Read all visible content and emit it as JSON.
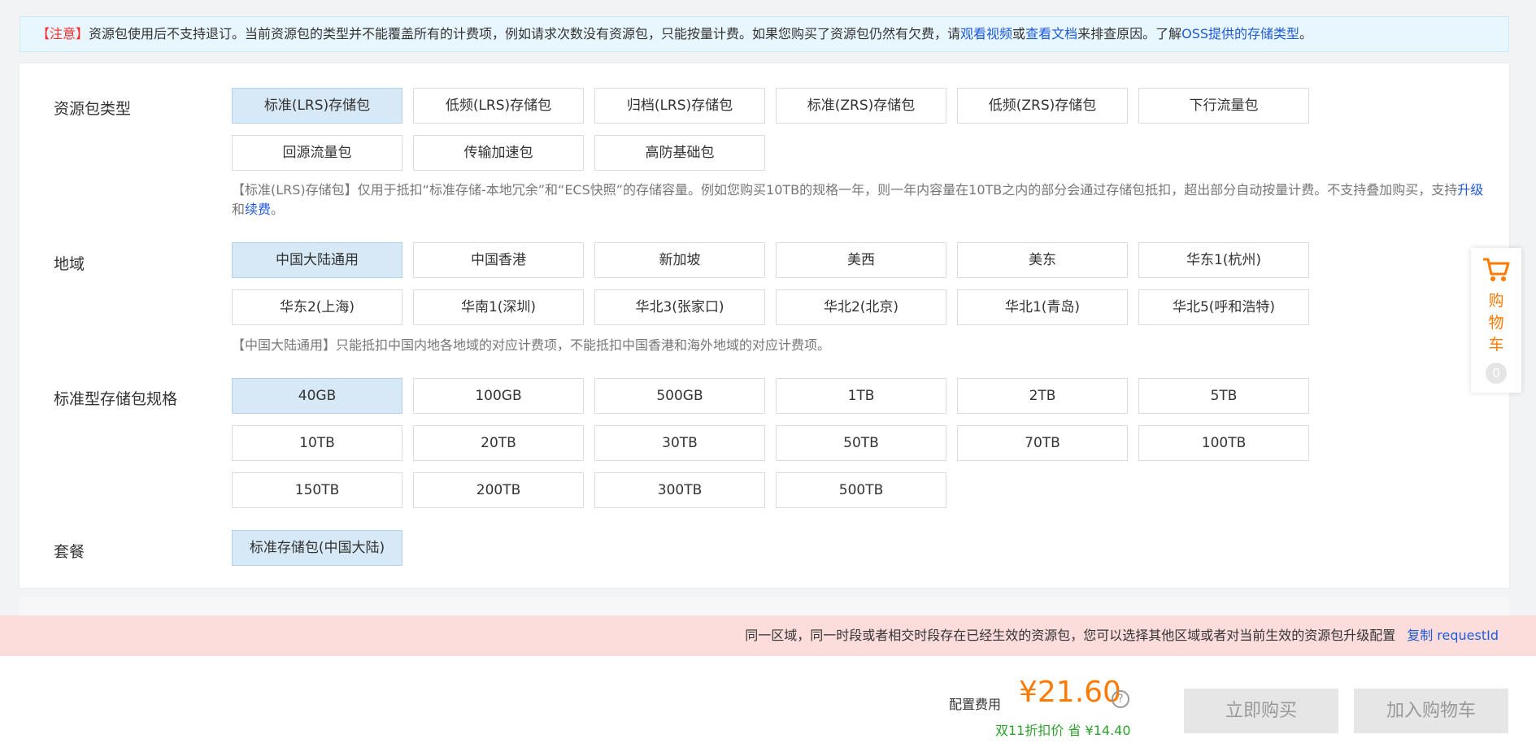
{
  "notice": {
    "prefix": "【注意】",
    "text1": "资源包使用后不支持退订。当前资源包的类型并不能覆盖所有的计费项，例如请求次数没有资源包，只能按量计费。如果您购买了资源包仍然有欠费，请",
    "link1": "观看视频",
    "or": "或",
    "link2": "查看文档",
    "text2": "来排查原因。了解",
    "link3": "OSS提供的存储类型",
    "end": "。"
  },
  "package_type": {
    "label": "资源包类型",
    "options": [
      "标准(LRS)存储包",
      "低频(LRS)存储包",
      "归档(LRS)存储包",
      "标准(ZRS)存储包",
      "低频(ZRS)存储包",
      "下行流量包",
      "回源流量包",
      "传输加速包",
      "高防基础包"
    ],
    "selected_index": 0,
    "desc1": "【标准(LRS)存储包】仅用于抵扣“标准存储-本地冗余”和“ECS快照”的存储容量。例如您购买10TB的规格一年，则一年内容量在10TB之内的部分会通过存储包抵扣，超出部分自动按量计费。不支持叠加购买，支持",
    "upgrade": "升级",
    "and": "和",
    "renew": "续费",
    "end": "。"
  },
  "region": {
    "label": "地域",
    "options": [
      "中国大陆通用",
      "中国香港",
      "新加坡",
      "美西",
      "美东",
      "华东1(杭州)",
      "华东2(上海)",
      "华南1(深圳)",
      "华北3(张家口)",
      "华北2(北京)",
      "华北1(青岛)",
      "华北5(呼和浩特)"
    ],
    "selected_index": 0,
    "desc": "【中国大陆通用】只能抵扣中国内地各地域的对应计费项，不能抵扣中国香港和海外地域的对应计费项。"
  },
  "spec": {
    "label": "标准型存储包规格",
    "options": [
      "40GB",
      "100GB",
      "500GB",
      "1TB",
      "2TB",
      "5TB",
      "10TB",
      "20TB",
      "30TB",
      "50TB",
      "70TB",
      "100TB",
      "150TB",
      "200TB",
      "300TB",
      "500TB"
    ],
    "selected_index": 0
  },
  "plan": {
    "label": "套餐",
    "options": [
      "标准存储包(中国大陆)"
    ],
    "selected_index": 0
  },
  "error_bar": {
    "message": "同一区域，同一时段或者相交时段存在已经生效的资源包，您可以选择其他区域或者对当前生效的资源包升级配置",
    "copy_label": "复制 requestId"
  },
  "footer": {
    "cost_label": "配置费用",
    "price": "¥21.60",
    "help_glyph": "?",
    "promo": "双11折扣价 省 ¥14.40",
    "buy_label": "立即购买",
    "add_cart_label": "加入购物车"
  },
  "cart": {
    "label_chars": [
      "购",
      "物",
      "车"
    ],
    "count": "0"
  },
  "colors": {
    "accent": "#ff7a00",
    "link": "#1f5bd8",
    "selected_bg": "#d7e8f6",
    "error_bg": "#fddcdc",
    "promo_green": "#2ca02c"
  }
}
